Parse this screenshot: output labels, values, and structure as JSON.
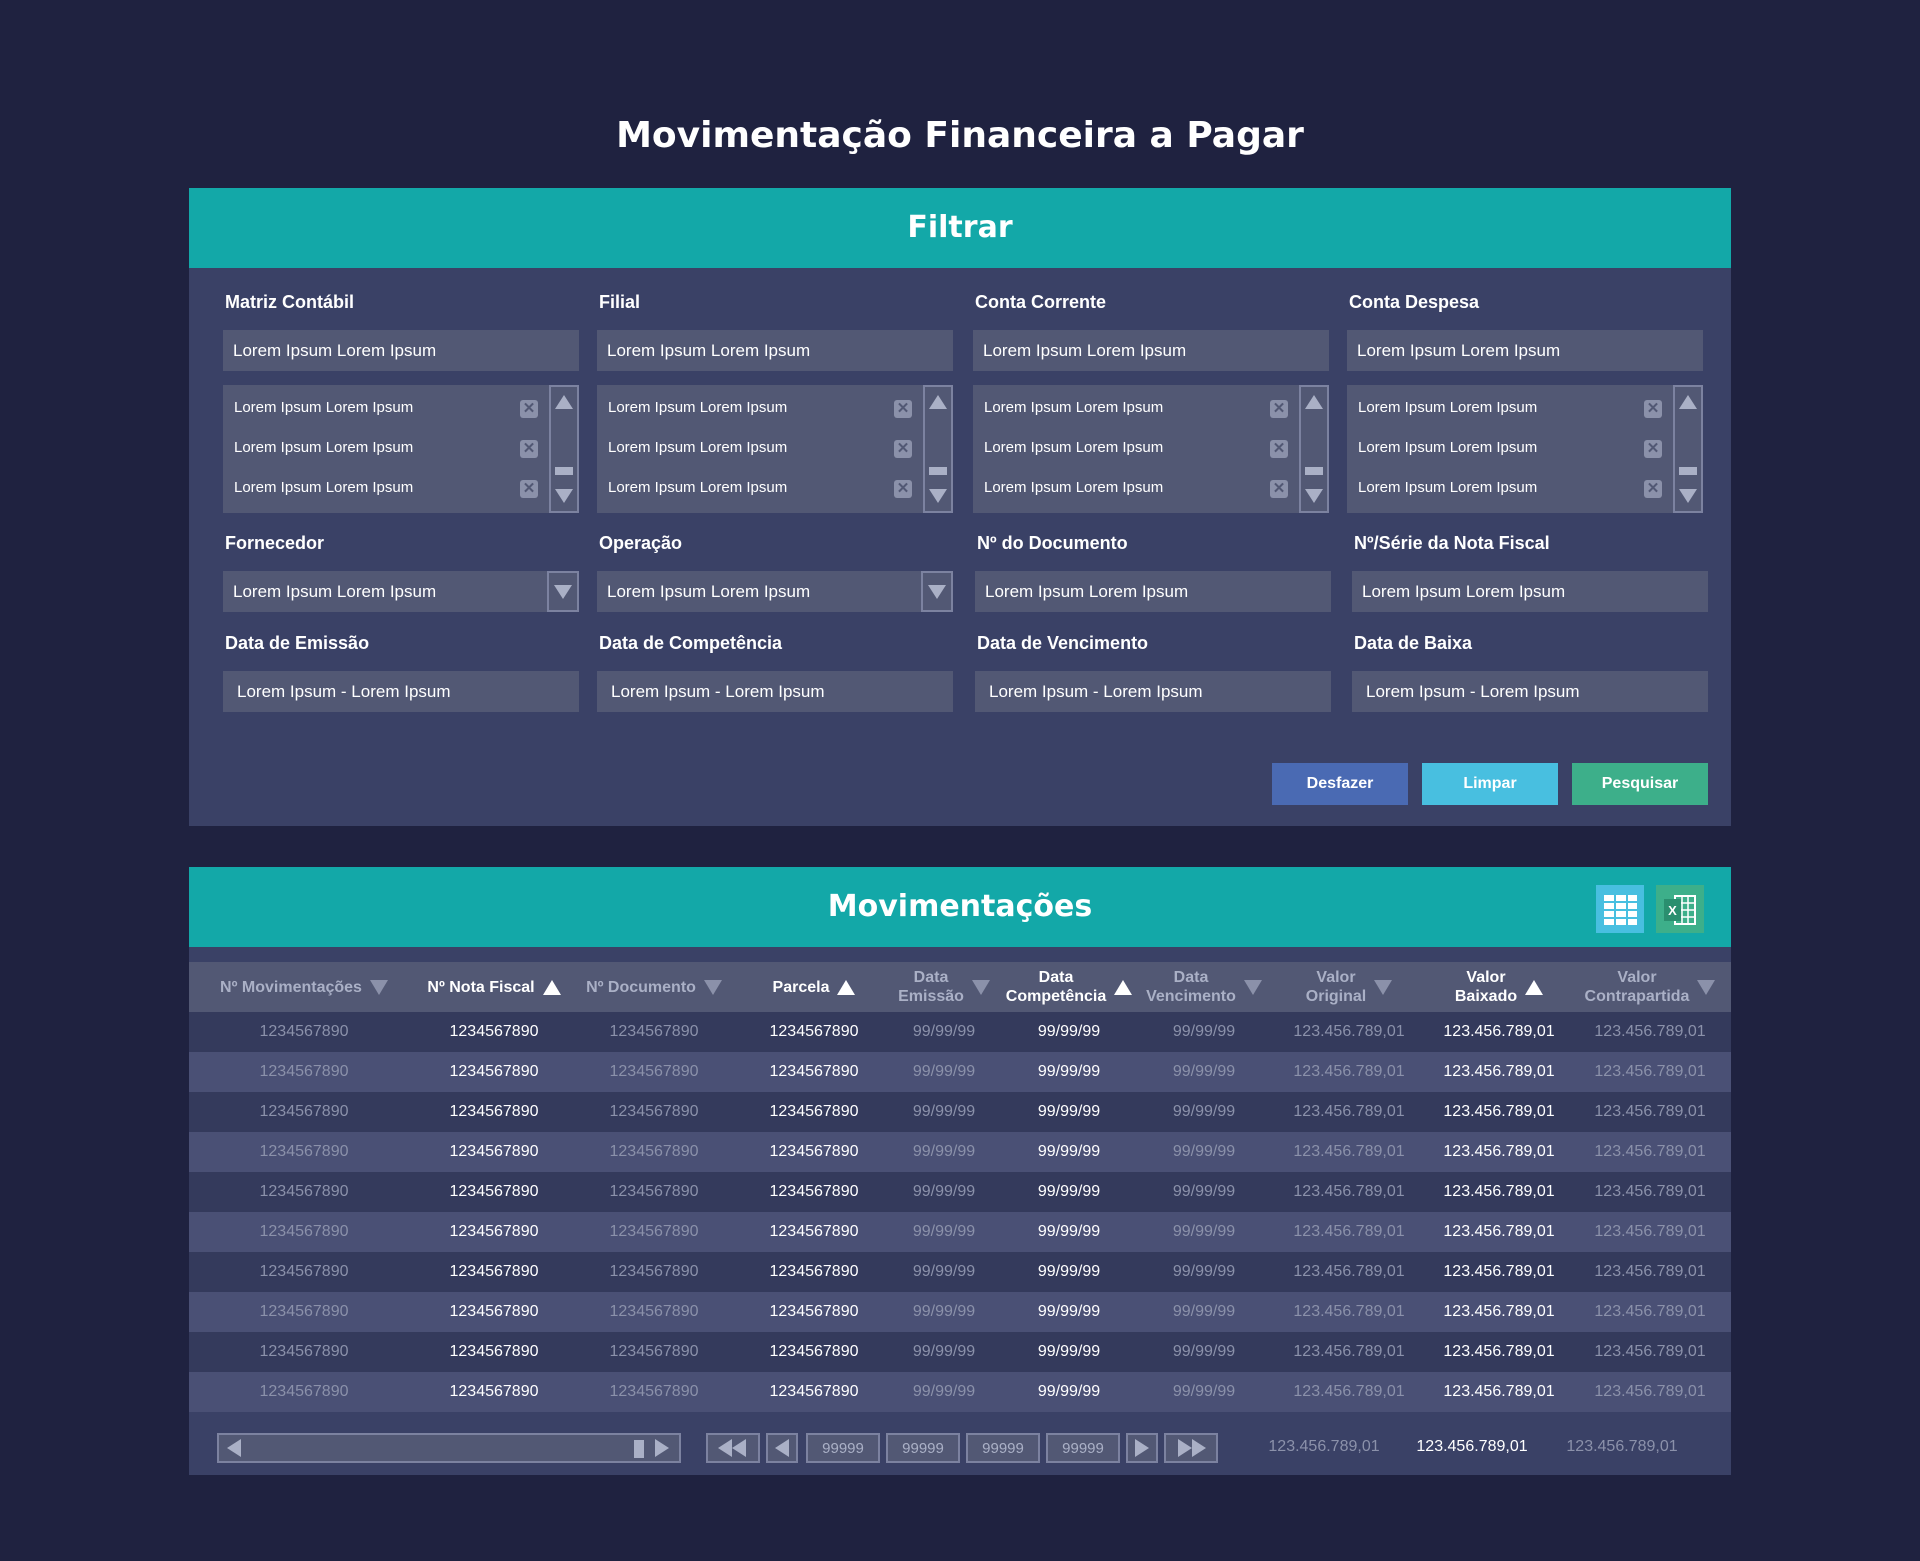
{
  "page_title": "Movimentação Financeira a Pagar",
  "filter": {
    "heading": "Filtrar",
    "fields_row1": [
      {
        "label": "Matriz Contábil",
        "value": "Lorem  Ipsum  Lorem  Ipsum",
        "list": [
          "Lorem  Ipsum  Lorem  Ipsum",
          "Lorem  Ipsum  Lorem  Ipsum",
          "Lorem  Ipsum  Lorem  Ipsum"
        ]
      },
      {
        "label": "Filial",
        "value": "Lorem  Ipsum  Lorem  Ipsum",
        "list": [
          "Lorem  Ipsum  Lorem  Ipsum",
          "Lorem  Ipsum  Lorem  Ipsum",
          "Lorem  Ipsum  Lorem  Ipsum"
        ]
      },
      {
        "label": "Conta Corrente",
        "value": "Lorem  Ipsum  Lorem  Ipsum",
        "list": [
          "Lorem  Ipsum  Lorem  Ipsum",
          "Lorem  Ipsum  Lorem  Ipsum",
          "Lorem  Ipsum  Lorem  Ipsum"
        ]
      },
      {
        "label": "Conta Despesa",
        "value": "Lorem  Ipsum  Lorem  Ipsum",
        "list": [
          "Lorem  Ipsum  Lorem  Ipsum",
          "Lorem  Ipsum  Lorem  Ipsum",
          "Lorem  Ipsum  Lorem  Ipsum"
        ]
      }
    ],
    "fields_row2": [
      {
        "label": "Fornecedor",
        "value": "Lorem  Ipsum  Lorem  Ipsum"
      },
      {
        "label": "Operação",
        "value": "Lorem  Ipsum  Lorem  Ipsum"
      },
      {
        "label": "Nº do Documento",
        "value": "Lorem  Ipsum  Lorem  Ipsum"
      },
      {
        "label": "Nº/Série da Nota Fiscal",
        "value": "Lorem  Ipsum  Lorem  Ipsum"
      }
    ],
    "fields_row3": [
      {
        "label": "Data de Emissão",
        "value": "Lorem  Ipsum  -  Lorem  Ipsum"
      },
      {
        "label": "Data de Competência",
        "value": "Lorem  Ipsum  -  Lorem  Ipsum"
      },
      {
        "label": "Data de Vencimento",
        "value": "Lorem  Ipsum  -  Lorem  Ipsum"
      },
      {
        "label": "Data de Baixa",
        "value": "Lorem  Ipsum  -  Lorem  Ipsum"
      }
    ],
    "buttons": {
      "undo": "Desfazer",
      "clear": "Limpar",
      "search": "Pesquisar"
    },
    "colors": {
      "undo": "#4a6ab3",
      "clear": "#48bfe0",
      "search": "#3daf8a"
    }
  },
  "movements": {
    "heading": "Movimentações",
    "icons": [
      "grid-view-icon",
      "excel-export-icon"
    ],
    "columns": [
      {
        "l1": "Nº Movimentações",
        "l2": "",
        "sort": "down",
        "strong": false
      },
      {
        "l1": "Nº Nota Fiscal",
        "l2": "",
        "sort": "up",
        "strong": true
      },
      {
        "l1": "Nº Documento",
        "l2": "",
        "sort": "down",
        "strong": false
      },
      {
        "l1": "Parcela",
        "l2": "",
        "sort": "up",
        "strong": true
      },
      {
        "l1": "Data",
        "l2": "Emissão",
        "sort": "down",
        "strong": false
      },
      {
        "l1": "Data",
        "l2": "Competência",
        "sort": "up",
        "strong": true
      },
      {
        "l1": "Data",
        "l2": "Vencimento",
        "sort": "down",
        "strong": false
      },
      {
        "l1": "Valor",
        "l2": "Original",
        "sort": "down",
        "strong": false
      },
      {
        "l1": "Valor",
        "l2": "Baixado",
        "sort": "up",
        "strong": true
      },
      {
        "l1": "Valor",
        "l2": "Contrapartida",
        "sort": "down",
        "strong": false
      }
    ],
    "rows": [
      [
        "1234567890",
        "1234567890",
        "1234567890",
        "1234567890",
        "99/99/99",
        "99/99/99",
        "99/99/99",
        "123.456.789,01",
        "123.456.789,01",
        "123.456.789,01"
      ],
      [
        "1234567890",
        "1234567890",
        "1234567890",
        "1234567890",
        "99/99/99",
        "99/99/99",
        "99/99/99",
        "123.456.789,01",
        "123.456.789,01",
        "123.456.789,01"
      ],
      [
        "1234567890",
        "1234567890",
        "1234567890",
        "1234567890",
        "99/99/99",
        "99/99/99",
        "99/99/99",
        "123.456.789,01",
        "123.456.789,01",
        "123.456.789,01"
      ],
      [
        "1234567890",
        "1234567890",
        "1234567890",
        "1234567890",
        "99/99/99",
        "99/99/99",
        "99/99/99",
        "123.456.789,01",
        "123.456.789,01",
        "123.456.789,01"
      ],
      [
        "1234567890",
        "1234567890",
        "1234567890",
        "1234567890",
        "99/99/99",
        "99/99/99",
        "99/99/99",
        "123.456.789,01",
        "123.456.789,01",
        "123.456.789,01"
      ],
      [
        "1234567890",
        "1234567890",
        "1234567890",
        "1234567890",
        "99/99/99",
        "99/99/99",
        "99/99/99",
        "123.456.789,01",
        "123.456.789,01",
        "123.456.789,01"
      ],
      [
        "1234567890",
        "1234567890",
        "1234567890",
        "1234567890",
        "99/99/99",
        "99/99/99",
        "99/99/99",
        "123.456.789,01",
        "123.456.789,01",
        "123.456.789,01"
      ],
      [
        "1234567890",
        "1234567890",
        "1234567890",
        "1234567890",
        "99/99/99",
        "99/99/99",
        "99/99/99",
        "123.456.789,01",
        "123.456.789,01",
        "123.456.789,01"
      ],
      [
        "1234567890",
        "1234567890",
        "1234567890",
        "1234567890",
        "99/99/99",
        "99/99/99",
        "99/99/99",
        "123.456.789,01",
        "123.456.789,01",
        "123.456.789,01"
      ],
      [
        "1234567890",
        "1234567890",
        "1234567890",
        "1234567890",
        "99/99/99",
        "99/99/99",
        "99/99/99",
        "123.456.789,01",
        "123.456.789,01",
        "123.456.789,01"
      ]
    ],
    "pagination": {
      "pages": [
        "99999",
        "99999",
        "99999",
        "99999"
      ]
    },
    "totals": [
      "123.456.789,01",
      "123.456.789,01",
      "123.456.789,01"
    ]
  }
}
